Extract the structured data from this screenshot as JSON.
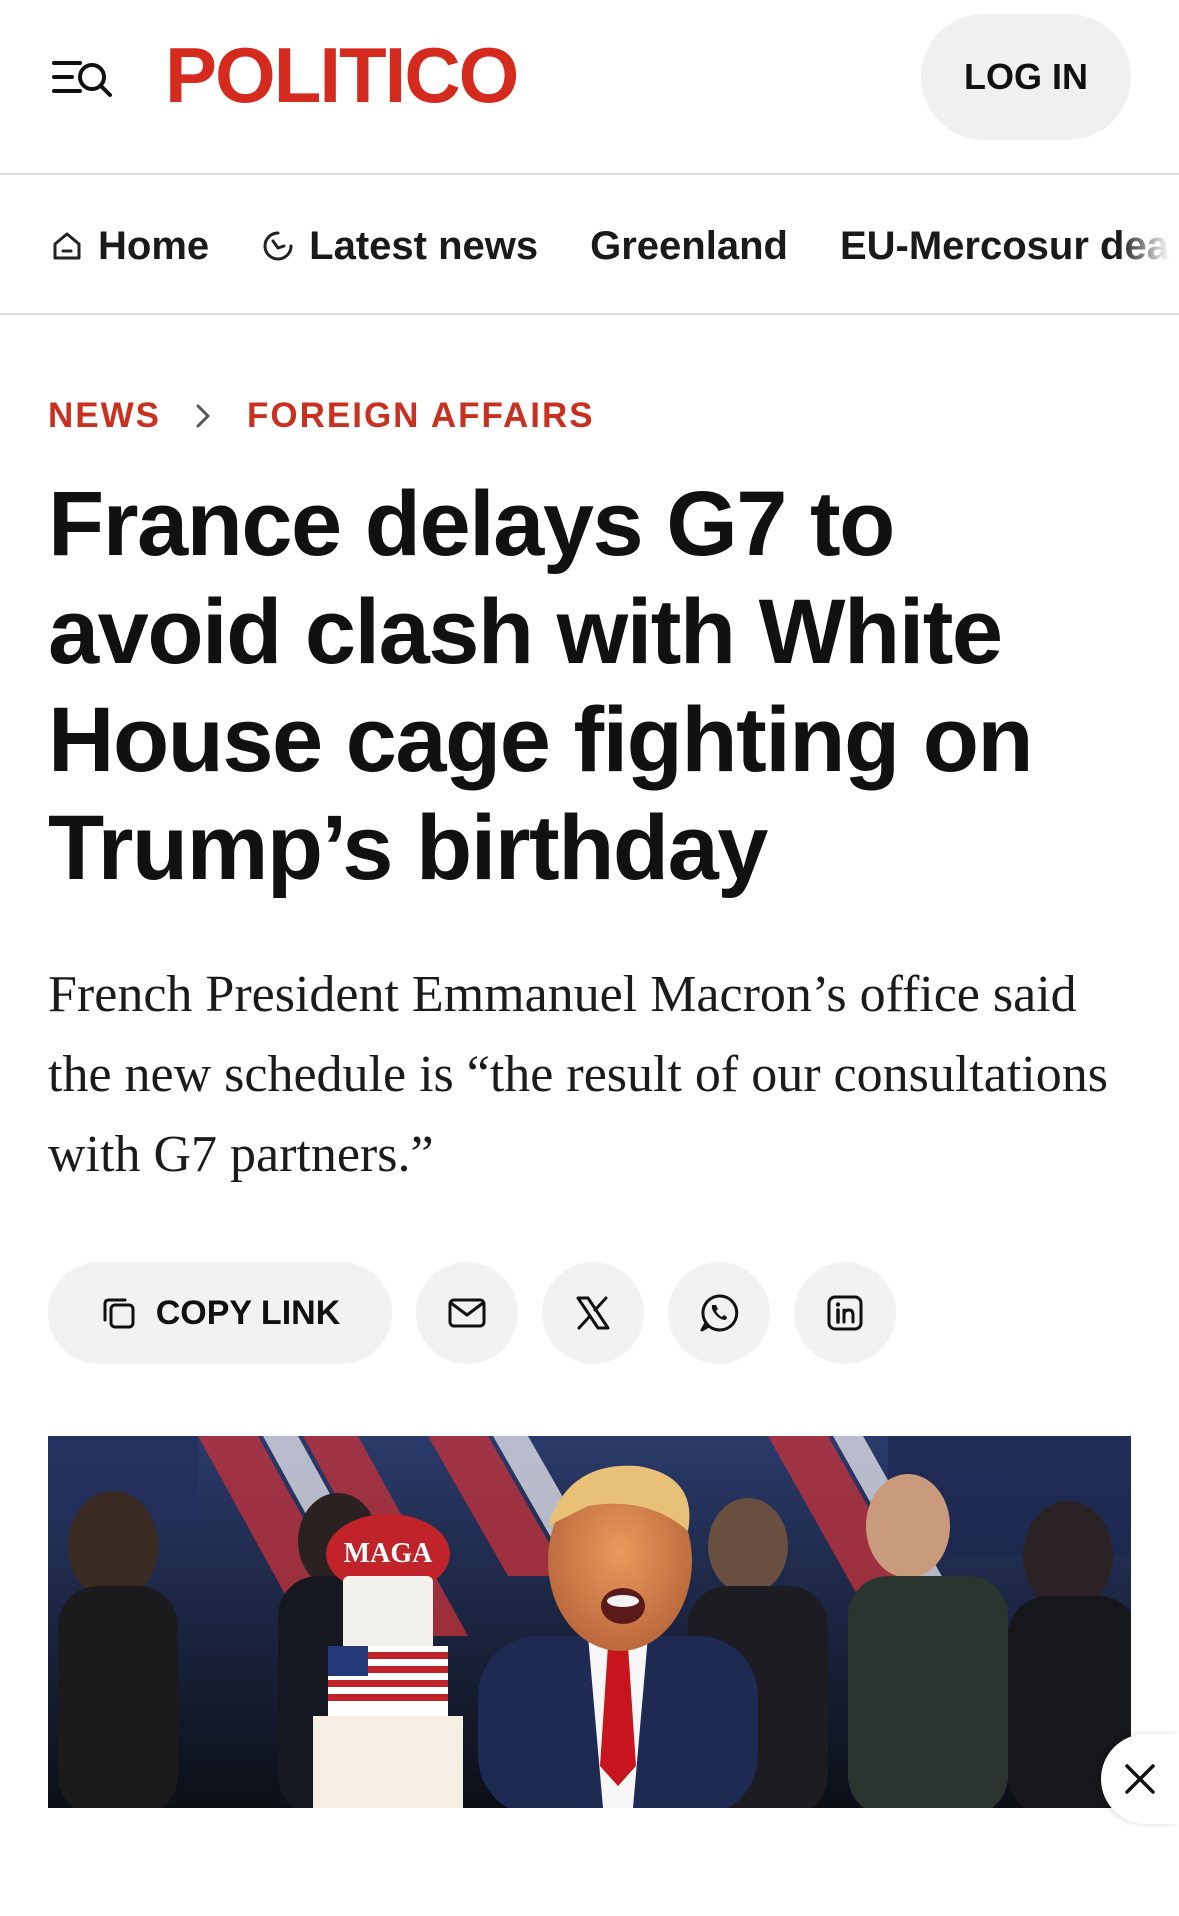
{
  "header": {
    "logo_text": "POLITICO",
    "login_label": "LOG IN",
    "brand_color": "#d52b1e",
    "menu_icon": "menu-search-icon"
  },
  "nav": {
    "items": [
      {
        "label": "Home",
        "icon": "home-icon"
      },
      {
        "label": "Latest news",
        "icon": "clock-icon"
      },
      {
        "label": "Greenland",
        "icon": ""
      },
      {
        "label": "EU-Mercosur dea",
        "icon": ""
      }
    ]
  },
  "breadcrumb": {
    "items": [
      "NEWS",
      "FOREIGN AFFAIRS"
    ],
    "color": "#c8311f"
  },
  "article": {
    "headline": "France delays G7 to avoid clash with White House cage fighting on Trump’s birthday",
    "dek": "French President Emmanuel Macron’s office said the new schedule is “the result of our consultations with G7 partners.”"
  },
  "share": {
    "copy_link_label": "COPY LINK",
    "buttons": [
      "email-icon",
      "x-icon",
      "whatsapp-icon",
      "linkedin-icon"
    ]
  },
  "hero_image": {
    "cake_badge_text": "MAGA"
  },
  "overlay": {
    "close_icon": "close-icon"
  }
}
